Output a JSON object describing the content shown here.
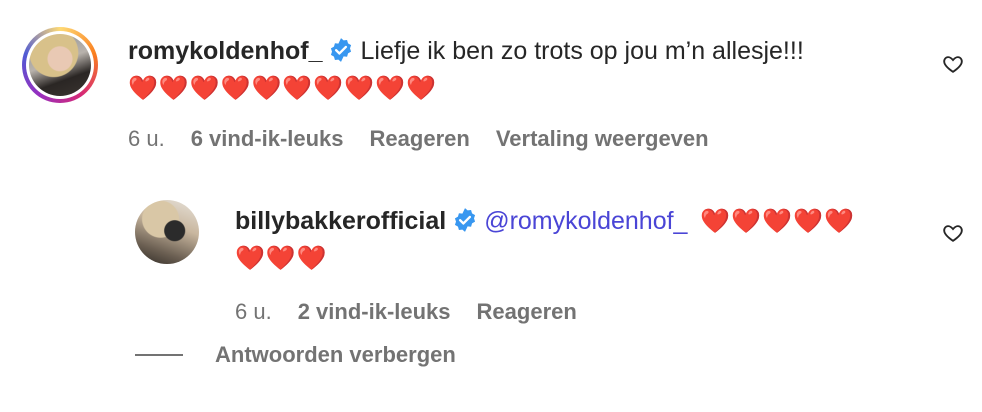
{
  "comments": [
    {
      "username": "romykoldenhof_",
      "verified": true,
      "text": "Liefje ik ben zo trots op jou m’n allesje!!!",
      "hearts": "❤️❤️❤️❤️❤️❤️❤️❤️❤️❤️",
      "time": "6 u.",
      "likes": "6 vind-ik-leuks",
      "reply_label": "Reageren",
      "translate_label": "Vertaling weergeven",
      "like_icon": "heart-outline-icon"
    }
  ],
  "reply": {
    "username": "billybakkerofficial",
    "verified": true,
    "mention": "@romykoldenhof_",
    "hearts_inline": "❤️❤️❤️❤️❤️",
    "hearts_second": "❤️❤️❤️",
    "time": "6 u.",
    "likes": "2 vind-ik-leuks",
    "reply_label": "Reageren",
    "like_icon": "heart-outline-icon"
  },
  "hide_replies_label": "Antwoorden verbergen",
  "colors": {
    "text": "#262626",
    "secondary": "#737373",
    "mention": "#4a45d6",
    "verified": "#3897f0",
    "heart": "#e0245e"
  }
}
